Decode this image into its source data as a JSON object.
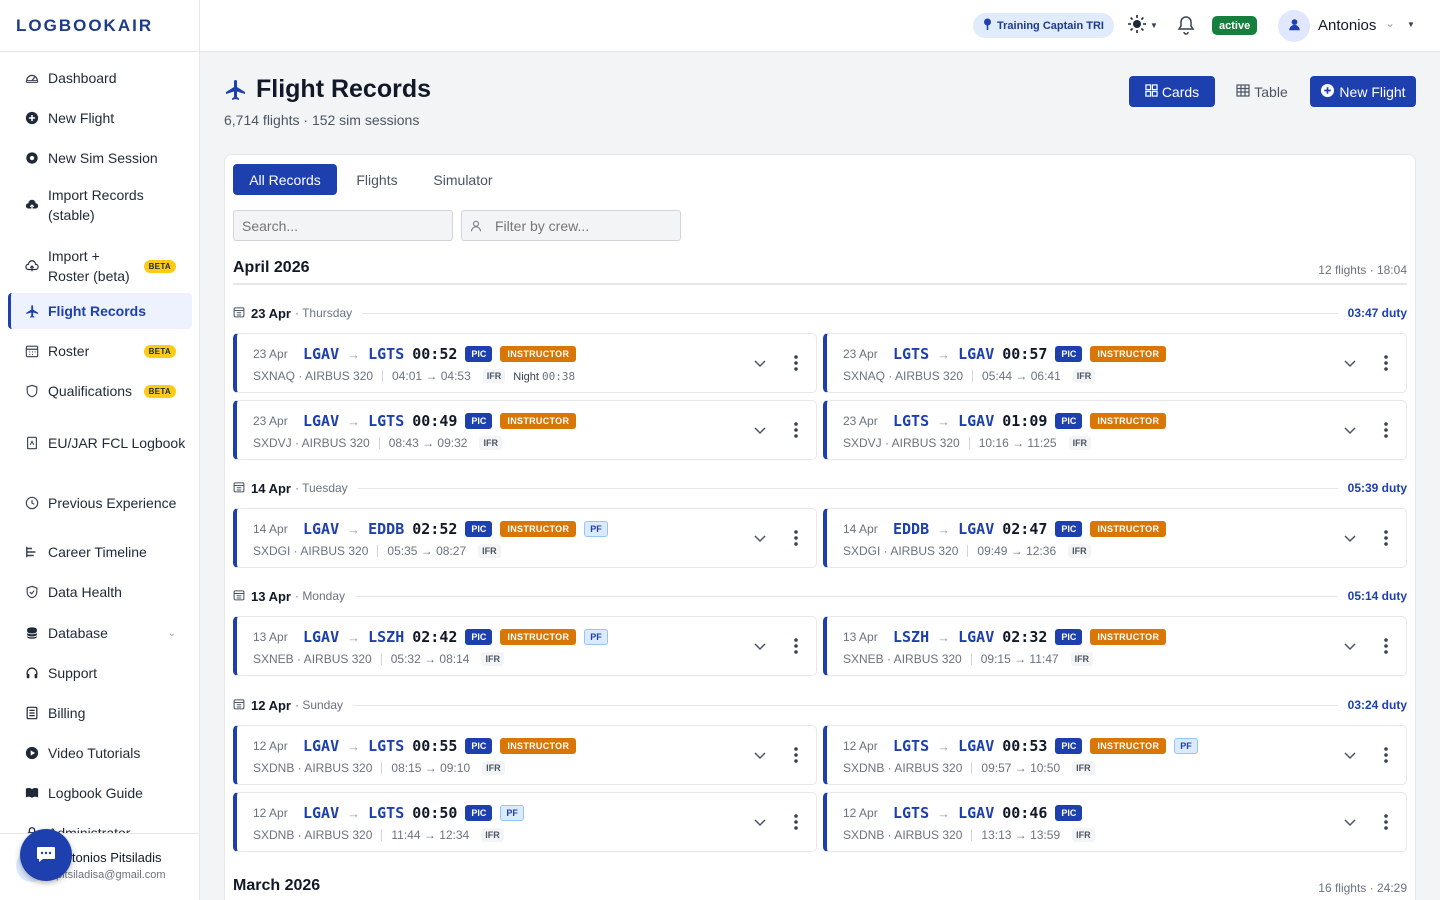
{
  "app": {
    "logo": "LOGBOOKAIR"
  },
  "sidebar": {
    "items": [
      {
        "label": "Dashboard",
        "icon": "gauge-icon"
      },
      {
        "label": "New Flight",
        "icon": "plus-circle-icon"
      },
      {
        "label": "New Sim Session",
        "icon": "gear-icon"
      },
      {
        "label": "Import Records (stable)",
        "icon": "cloud-upload-icon"
      },
      {
        "label": "Import + Roster (beta)",
        "icon": "cloud-upload-icon",
        "badge": "BETA"
      },
      {
        "label": "Flight Records",
        "icon": "plane-icon",
        "active": true
      },
      {
        "label": "Roster",
        "icon": "calendar-icon",
        "badge": "BETA"
      },
      {
        "label": "Qualifications",
        "icon": "shield-icon",
        "badge": "BETA"
      },
      {
        "label": "EU/JAR FCL Logbook",
        "icon": "book-icon"
      },
      {
        "label": "Previous Experience",
        "icon": "clock-icon"
      },
      {
        "label": "Career Timeline",
        "icon": "timeline-icon"
      },
      {
        "label": "Data Health",
        "icon": "shield-check-icon"
      },
      {
        "label": "Database",
        "icon": "database-icon",
        "expand": true
      },
      {
        "label": "Support",
        "icon": "headset-icon"
      },
      {
        "label": "Billing",
        "icon": "receipt-icon"
      },
      {
        "label": "Video Tutorials",
        "icon": "play-icon"
      },
      {
        "label": "Logbook Guide",
        "icon": "book-open-icon"
      },
      {
        "label": "Administrator",
        "icon": "lock-icon",
        "expand": true
      }
    ],
    "user": {
      "name": "Antonios Pitsiladis",
      "email": "pitsiladisa@gmail.com"
    }
  },
  "topbar": {
    "role": "Training Captain TRI",
    "status": "active",
    "username": "Antonios"
  },
  "page": {
    "title": "Flight Records",
    "subtitle": "6,714 flights · 152 sim sessions",
    "view_cards": "Cards",
    "view_table": "Table",
    "new_flight": "New Flight"
  },
  "filters": {
    "tabs": [
      "All Records",
      "Flights",
      "Simulator"
    ],
    "search_placeholder": "Search...",
    "crew_placeholder": "Filter by crew..."
  },
  "months": [
    {
      "name": "April 2026",
      "summary": "12 flights · 18:04"
    },
    {
      "name": "March 2026",
      "summary": "16 flights · 24:29"
    }
  ],
  "days": [
    {
      "date": "23 Apr",
      "weekday": "· Thursday",
      "duty": "03:47 duty"
    },
    {
      "date": "14 Apr",
      "weekday": "· Tuesday",
      "duty": "05:39 duty"
    },
    {
      "date": "13 Apr",
      "weekday": "· Monday",
      "duty": "05:14 duty"
    },
    {
      "date": "12 Apr",
      "weekday": "· Sunday",
      "duty": "03:24 duty"
    }
  ],
  "flights": [
    {
      "date": "23 Apr",
      "from": "LGAV",
      "to": "LGTS",
      "duration": "00:52",
      "reg": "SXNAQ · AIRBUS 320",
      "times": "04:01 → 04:53",
      "rules": "IFR",
      "night_label": "Night",
      "night": "00:38",
      "pic": "PIC",
      "instructor": "INSTRUCTOR",
      "pf": ""
    },
    {
      "date": "23 Apr",
      "from": "LGTS",
      "to": "LGAV",
      "duration": "00:57",
      "reg": "SXNAQ · AIRBUS 320",
      "times": "05:44 → 06:41",
      "rules": "IFR",
      "night_label": "",
      "night": "",
      "pic": "PIC",
      "instructor": "INSTRUCTOR",
      "pf": ""
    },
    {
      "date": "23 Apr",
      "from": "LGAV",
      "to": "LGTS",
      "duration": "00:49",
      "reg": "SXDVJ · AIRBUS 320",
      "times": "08:43 → 09:32",
      "rules": "IFR",
      "night_label": "",
      "night": "",
      "pic": "PIC",
      "instructor": "INSTRUCTOR",
      "pf": ""
    },
    {
      "date": "23 Apr",
      "from": "LGTS",
      "to": "LGAV",
      "duration": "01:09",
      "reg": "SXDVJ · AIRBUS 320",
      "times": "10:16 → 11:25",
      "rules": "IFR",
      "night_label": "",
      "night": "",
      "pic": "PIC",
      "instructor": "INSTRUCTOR",
      "pf": ""
    },
    {
      "date": "14 Apr",
      "from": "LGAV",
      "to": "EDDB",
      "duration": "02:52",
      "reg": "SXDGI · AIRBUS 320",
      "times": "05:35 → 08:27",
      "rules": "IFR",
      "night_label": "",
      "night": "",
      "pic": "PIC",
      "instructor": "INSTRUCTOR",
      "pf": "PF"
    },
    {
      "date": "14 Apr",
      "from": "EDDB",
      "to": "LGAV",
      "duration": "02:47",
      "reg": "SXDGI · AIRBUS 320",
      "times": "09:49 → 12:36",
      "rules": "IFR",
      "night_label": "",
      "night": "",
      "pic": "PIC",
      "instructor": "INSTRUCTOR",
      "pf": ""
    },
    {
      "date": "13 Apr",
      "from": "LGAV",
      "to": "LSZH",
      "duration": "02:42",
      "reg": "SXNEB · AIRBUS 320",
      "times": "05:32 → 08:14",
      "rules": "IFR",
      "night_label": "",
      "night": "",
      "pic": "PIC",
      "instructor": "INSTRUCTOR",
      "pf": "PF"
    },
    {
      "date": "13 Apr",
      "from": "LSZH",
      "to": "LGAV",
      "duration": "02:32",
      "reg": "SXNEB · AIRBUS 320",
      "times": "09:15 → 11:47",
      "rules": "IFR",
      "night_label": "",
      "night": "",
      "pic": "PIC",
      "instructor": "INSTRUCTOR",
      "pf": ""
    },
    {
      "date": "12 Apr",
      "from": "LGAV",
      "to": "LGTS",
      "duration": "00:55",
      "reg": "SXDNB · AIRBUS 320",
      "times": "08:15 → 09:10",
      "rules": "IFR",
      "night_label": "",
      "night": "",
      "pic": "PIC",
      "instructor": "INSTRUCTOR",
      "pf": ""
    },
    {
      "date": "12 Apr",
      "from": "LGTS",
      "to": "LGAV",
      "duration": "00:53",
      "reg": "SXDNB · AIRBUS 320",
      "times": "09:57 → 10:50",
      "rules": "IFR",
      "night_label": "",
      "night": "",
      "pic": "PIC",
      "instructor": "INSTRUCTOR",
      "pf": "PF"
    },
    {
      "date": "12 Apr",
      "from": "LGAV",
      "to": "LGTS",
      "duration": "00:50",
      "reg": "SXDNB · AIRBUS 320",
      "times": "11:44 → 12:34",
      "rules": "IFR",
      "night_label": "",
      "night": "",
      "pic": "PIC",
      "instructor": "",
      "pf": "PF"
    },
    {
      "date": "12 Apr",
      "from": "LGTS",
      "to": "LGAV",
      "duration": "00:46",
      "reg": "SXDNB · AIRBUS 320",
      "times": "13:13 → 13:59",
      "rules": "IFR",
      "night_label": "",
      "night": "",
      "pic": "PIC",
      "instructor": "",
      "pf": ""
    }
  ],
  "colors": {
    "brand": "#1e40af",
    "instructor": "#d97706",
    "active": "#15803d",
    "beta": "#facc15"
  }
}
